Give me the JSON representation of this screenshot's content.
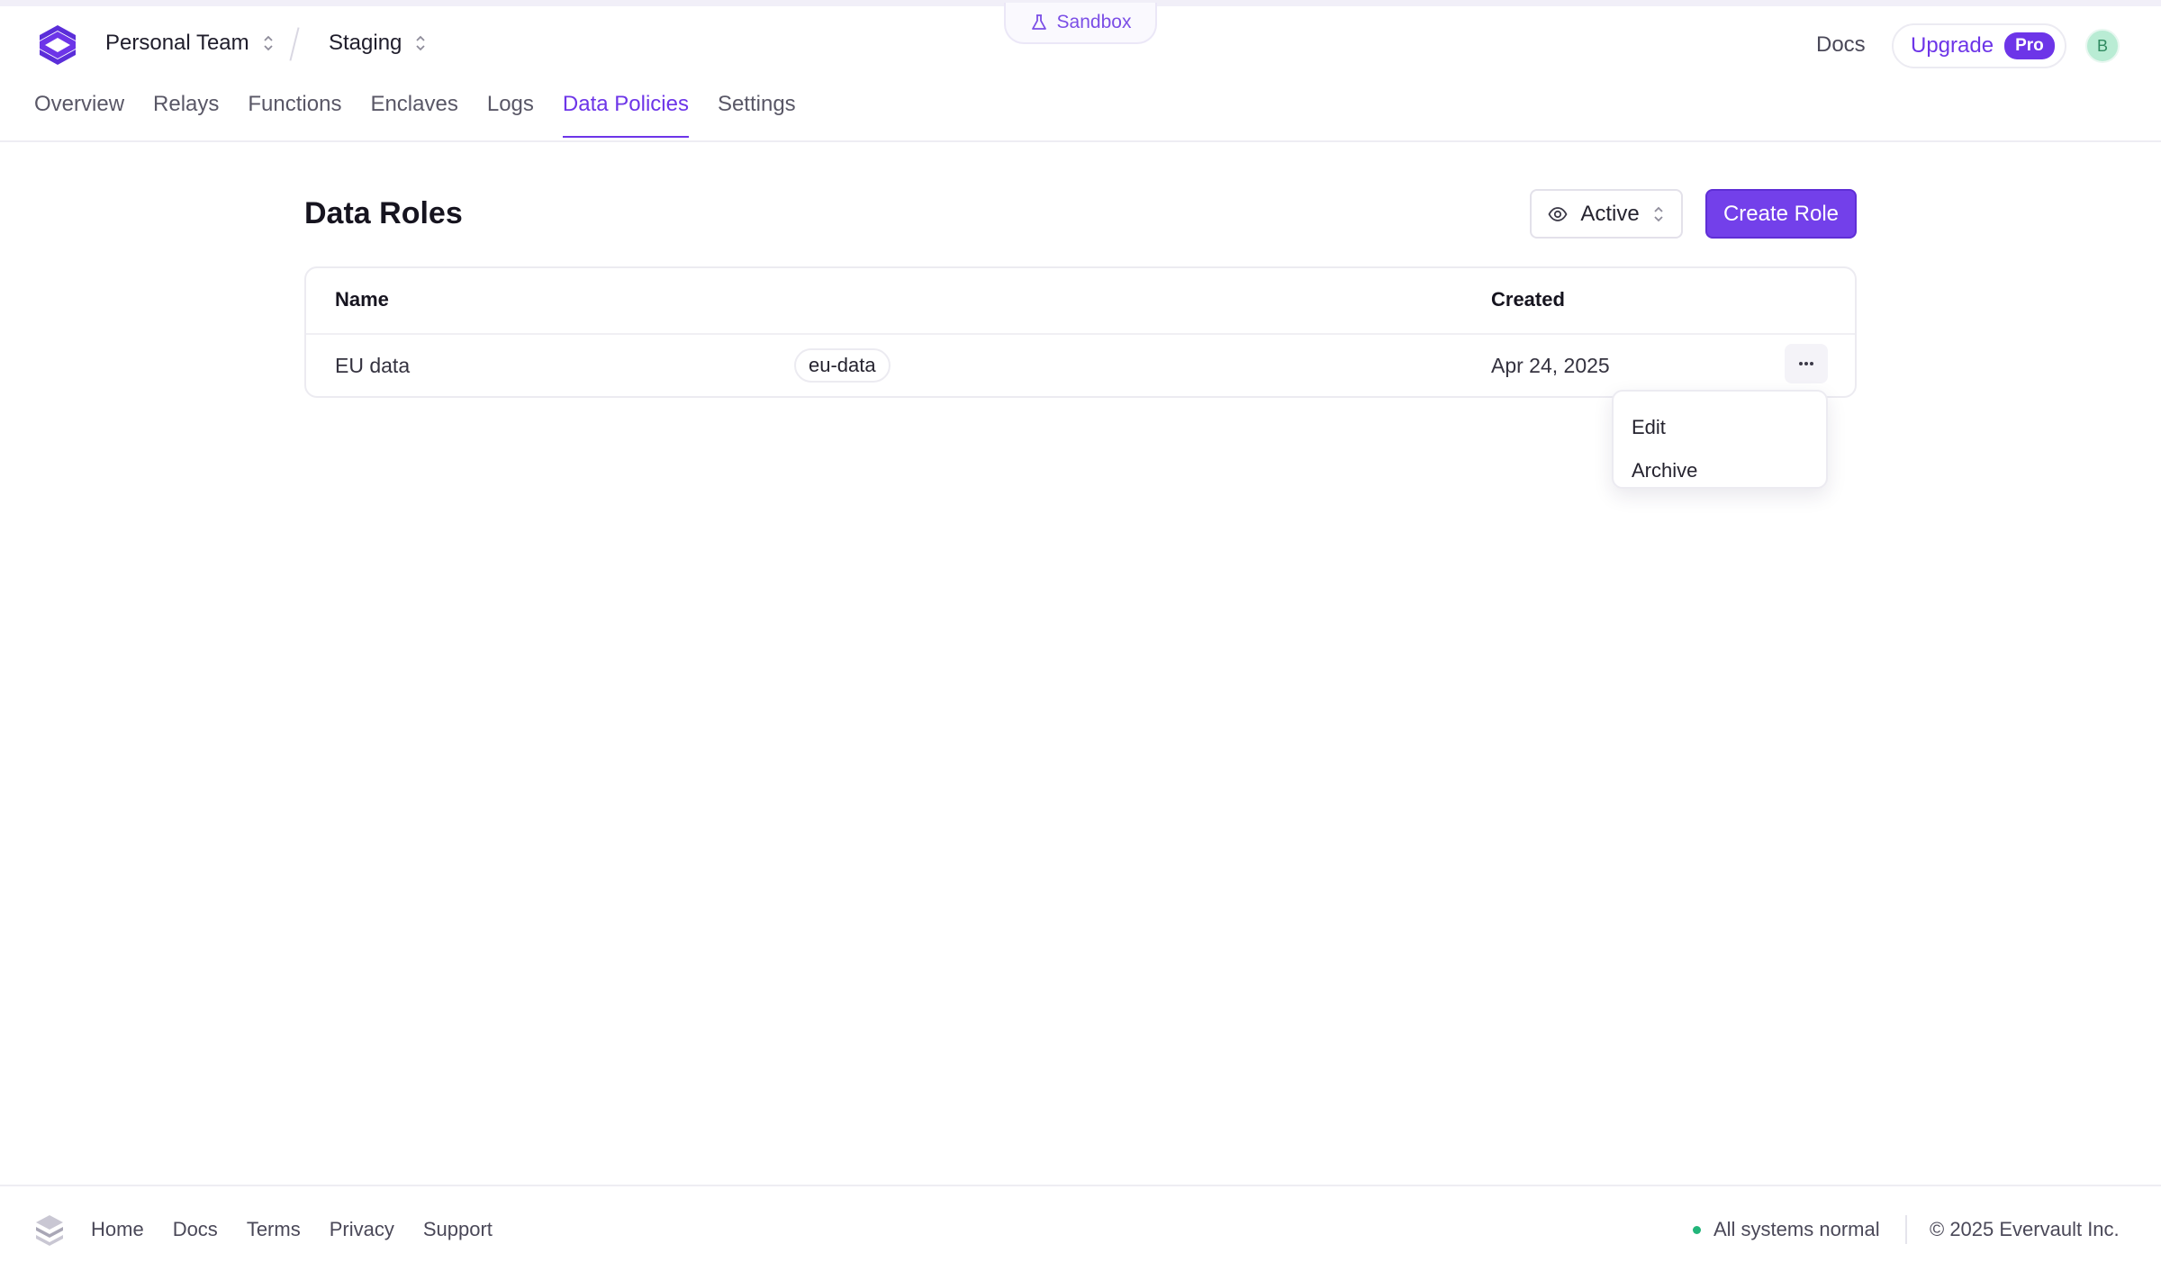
{
  "environment_banner": {
    "label": "Sandbox"
  },
  "header": {
    "team": "Personal Team",
    "app": "Staging",
    "docs_label": "Docs",
    "upgrade_label": "Upgrade",
    "pro_badge": "Pro",
    "avatar_initial": "B"
  },
  "tabs": [
    {
      "label": "Overview",
      "active": false
    },
    {
      "label": "Relays",
      "active": false
    },
    {
      "label": "Functions",
      "active": false
    },
    {
      "label": "Enclaves",
      "active": false
    },
    {
      "label": "Logs",
      "active": false
    },
    {
      "label": "Data Policies",
      "active": true
    },
    {
      "label": "Settings",
      "active": false
    }
  ],
  "page": {
    "title": "Data Roles",
    "filter_label": "Active",
    "create_label": "Create Role"
  },
  "table": {
    "columns": [
      "Name",
      "Created"
    ],
    "rows": [
      {
        "name": "EU data",
        "slug": "eu-data",
        "created": "Apr 24, 2025"
      }
    ]
  },
  "row_menu": {
    "items": [
      "Edit",
      "Archive"
    ]
  },
  "footer": {
    "links": [
      "Home",
      "Docs",
      "Terms",
      "Privacy",
      "Support"
    ],
    "status": "All systems normal",
    "copyright": "© 2025 Evervault Inc."
  },
  "colors": {
    "brand": "#6d35e8",
    "status_ok": "#22b57a"
  },
  "icons": {
    "logo": "evervault-logo-icon",
    "sandbox": "flask-icon",
    "switcher": "chevron-up-down-icon",
    "filter": "eye-icon",
    "row_actions": "more-horizontal-icon"
  }
}
